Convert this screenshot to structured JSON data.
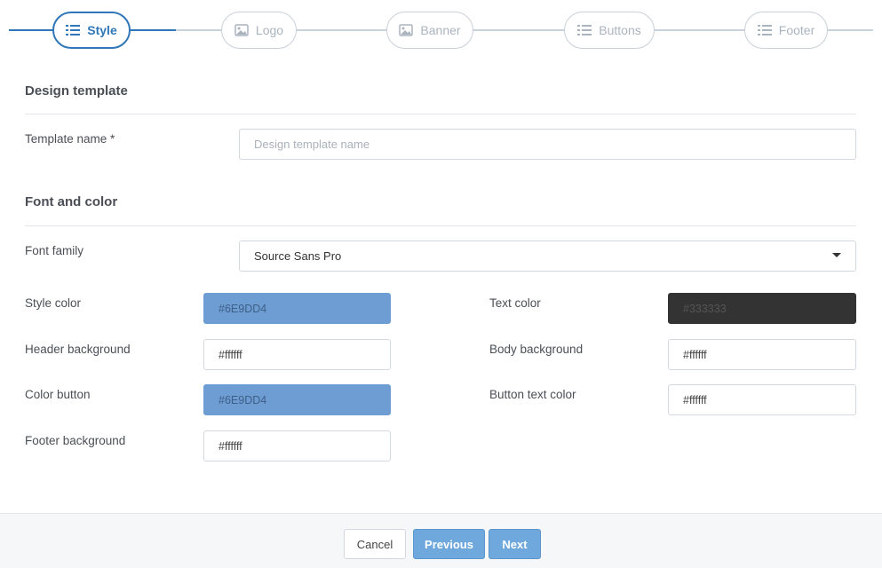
{
  "stepper": {
    "steps": [
      {
        "label": "Style",
        "icon": "list-icon",
        "active": true
      },
      {
        "label": "Logo",
        "icon": "image-icon",
        "active": false
      },
      {
        "label": "Banner",
        "icon": "image-icon",
        "active": false
      },
      {
        "label": "Buttons",
        "icon": "list-icon",
        "active": false
      },
      {
        "label": "Footer",
        "icon": "list-icon",
        "active": false
      }
    ]
  },
  "design_template": {
    "title": "Design template",
    "template_name_label": "Template name *",
    "template_name_placeholder": "Design template name",
    "template_name_value": ""
  },
  "font_and_color": {
    "title": "Font and color",
    "font_family_label": "Font family",
    "font_family_value": "Source Sans Pro",
    "colors": {
      "style_color": {
        "label": "Style color",
        "value": "#6E9DD4",
        "swatch": "#6e9dd4"
      },
      "text_color": {
        "label": "Text color",
        "value": "#333333",
        "swatch": "#333333"
      },
      "header_background": {
        "label": "Header background",
        "value": "#ffffff",
        "swatch": "#ffffff"
      },
      "body_background": {
        "label": "Body background",
        "value": "#ffffff",
        "swatch": "#ffffff"
      },
      "color_button": {
        "label": "Color button",
        "value": "#6E9DD4",
        "swatch": "#6e9dd4"
      },
      "button_text_color": {
        "label": "Button text color",
        "value": "#ffffff",
        "swatch": "#ffffff"
      },
      "footer_background": {
        "label": "Footer background",
        "value": "#ffffff",
        "swatch": "#ffffff"
      }
    }
  },
  "footer": {
    "cancel_label": "Cancel",
    "previous_label": "Previous",
    "next_label": "Next"
  },
  "theme": {
    "accent": "#2f77b8",
    "button_primary": "#6fa8dc"
  }
}
